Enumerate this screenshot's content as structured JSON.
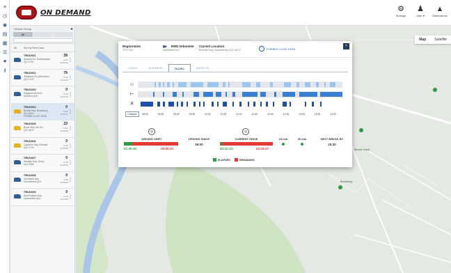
{
  "app": {
    "logo_text": "ON DEMAND",
    "colors": {
      "brand": "#b0141b",
      "navy": "#223a5e",
      "elapsed": "#2e9a44",
      "remaining": "#e53935",
      "activity": "#3a7fd0"
    }
  },
  "top_actions": [
    {
      "icon": "settings-icon",
      "label": "Settings"
    },
    {
      "icon": "user-icon",
      "label": "User ▾"
    },
    {
      "icon": "bell-icon",
      "label": "Notifications"
    }
  ],
  "rail_icons": [
    "menu-icon",
    "clock-icon",
    "map-pin-icon",
    "layers-icon",
    "grid-icon",
    "list-icon",
    "star-icon",
    "key-icon"
  ],
  "panel": {
    "title": "Vehicle Group",
    "tabs": [
      "All",
      "",
      ""
    ],
    "sort": [
      "All",
      "Sort by Time Desc"
    ],
    "rows": [
      {
        "name": "TRUCK01",
        "l1": "Beaufort Rd, Rockhampton",
        "l2": "QLD 4700",
        "l3": "",
        "num": "28",
        "m1": "km/h",
        "m2": "10:18:42",
        "m3": "",
        "color": "blue",
        "selected": false
      },
      {
        "name": "TRUCK02",
        "l1": "Gladstone Rd, Allenstown",
        "l2": "QLD 4700",
        "l3": "",
        "num": "76",
        "m1": "km/h",
        "m2": "10:18:40",
        "m3": "",
        "color": "blue",
        "selected": false
      },
      {
        "name": "TRUCK03",
        "l1": "Kingsford Smith Dr",
        "l2": "Hamilton QLD",
        "l3": "",
        "num": "0",
        "m1": "km/h",
        "m2": "10:18:35",
        "m3": "",
        "color": "blue",
        "selected": false
      },
      {
        "name": "TRUCK04",
        "l1": "Burnett Hwy, Bundaberg",
        "l2": "QLD 4670",
        "l3": "FORBES CLIVE JOHN",
        "num": "0",
        "m1": "km/h",
        "m2": "10:18:31",
        "m3": "",
        "color": "yellow",
        "selected": true
      },
      {
        "name": "TRUCK05",
        "l1": "Bruce Hwy, Gin Gin",
        "l2": "QLD 4671",
        "l3": "",
        "num": "23",
        "m1": "km/h",
        "m2": "10:18:28",
        "m3": "",
        "color": "yellow",
        "selected": false
      },
      {
        "name": "TRUCK06",
        "l1": "Capricorn Hwy, Emerald",
        "l2": "QLD 4720",
        "l3": "",
        "num": "0",
        "m1": "km/h",
        "m2": "10:18:20",
        "m3": "",
        "color": "yellow",
        "selected": false
      },
      {
        "name": "TRUCK07",
        "l1": "Warrego Hwy, Roma",
        "l2": "QLD 4455",
        "l3": "",
        "num": "0",
        "m1": "km/h",
        "m2": "10:18:12",
        "m3": "",
        "color": "blue",
        "selected": false
      },
      {
        "name": "TRUCK08",
        "l1": "Leichhardt Hwy",
        "l2": "Goondiwindi QLD",
        "l3": "",
        "num": "0",
        "m1": "km/h",
        "m2": "10:18:05",
        "m3": "",
        "color": "blue",
        "selected": false
      },
      {
        "name": "TRUCK09",
        "l1": "New England Hwy",
        "l2": "Toowoomba QLD",
        "l3": "",
        "num": "0",
        "m1": "km/h",
        "m2": "10:17:58",
        "m3": "",
        "color": "blue",
        "selected": false
      }
    ]
  },
  "map": {
    "type_options": [
      "Map",
      "Satellite"
    ],
    "active_type": "Map",
    "places": [
      "Burnett Heads",
      "Bundaberg"
    ]
  },
  "modal": {
    "registration_label": "Registration",
    "registration_value": "XXX 000",
    "ewd_label": "EWD Odometer",
    "ewd_value": "######## km",
    "location_label": "Current Location",
    "location_value": "Burnett Hwy, Bundaberg QLD 4670",
    "driver_name": "FORBES CLIVE JOHN",
    "close": "×",
    "tabs": [
      "TODAY",
      "BUSINESS",
      "TACHO",
      "DEFECTS"
    ],
    "active_tab": "TACHO",
    "timeline_button": "Collapse",
    "times": [
      "08:00",
      "08:30",
      "09:00",
      "09:30",
      "10:00",
      "10:30",
      "11:00",
      "11:30",
      "12:00",
      "12:30",
      "13:00",
      "13:30",
      "14:00"
    ],
    "stats": {
      "driving_shift_label": "DRIVING SHIFT",
      "driving_shift_elapsed": "01:40:40",
      "driving_shift_remaining": "08:59:20",
      "driving_shift_fraction": 0.16,
      "driving_since_label": "DRIVING SINCE",
      "driving_since_value": "08:00",
      "current_drive_label": "CURRENT DRIVE",
      "current_drive_elapsed": "00:10:13",
      "current_drive_remaining": "04:19:47",
      "current_drive_fraction": 0.04,
      "col_15_label": "15 min",
      "col_30_label": "30 min",
      "next_break_label": "NEXT BREAK BY",
      "next_break_value": "15:30"
    },
    "legend": {
      "elapsed": "ELAPSED",
      "remaining": "REMAINING"
    }
  }
}
